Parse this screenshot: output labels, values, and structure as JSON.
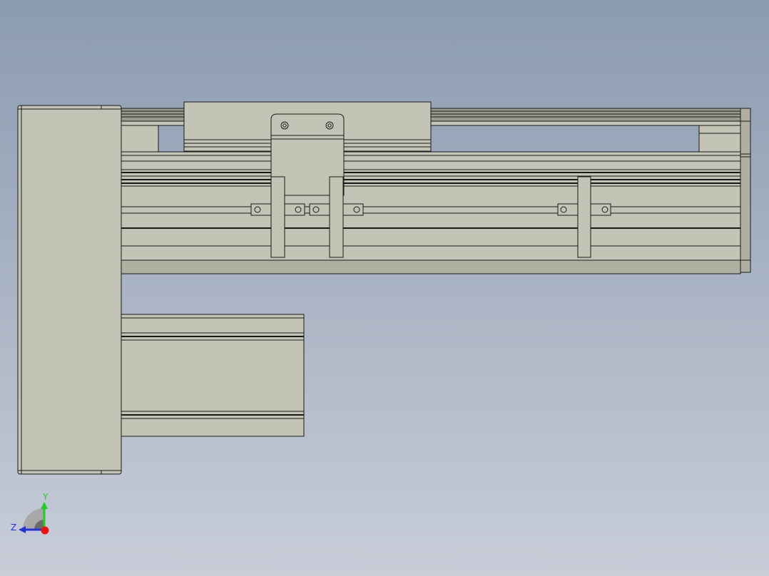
{
  "viewport": {
    "background_top": "#8b9bb0",
    "background_bottom": "#c8cdd8"
  },
  "model": {
    "part_fill": "#c4c4b6",
    "part_fill_dark": "#b0b0a2",
    "line_color": "#1a1a1a"
  },
  "triad": {
    "y_label": "Y",
    "z_label": "Z",
    "y_color": "#22cc22",
    "z_color": "#2233dd",
    "x_color": "#ee1111"
  }
}
